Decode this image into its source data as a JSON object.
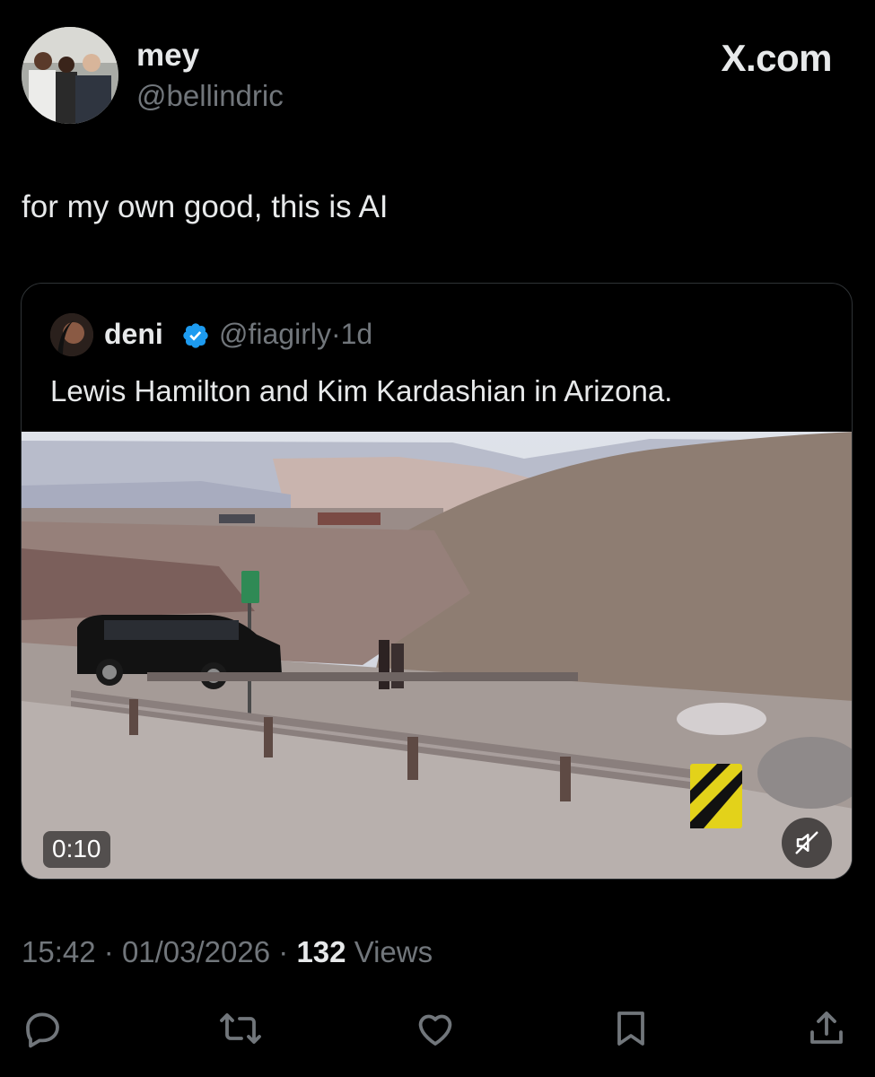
{
  "post": {
    "author_name": "mey",
    "author_handle": "@bellindric",
    "site_label": "X.com",
    "text": "for my own good, this is AI"
  },
  "quote": {
    "author_name": "deni",
    "verified": true,
    "author_handle": "@fiagirly",
    "separator": "·",
    "age": "1d",
    "text": "Lewis Hamilton and Kim Kardashian in Arizona.",
    "video": {
      "duration": "0:10",
      "muted": true
    }
  },
  "meta": {
    "time": "15:42",
    "separator": "·",
    "date": "01/03/2026",
    "views_count": "132",
    "views_label": "Views"
  },
  "actions": [
    "reply-icon",
    "repost-icon",
    "like-icon",
    "bookmark-icon",
    "share-icon"
  ],
  "colors": {
    "background": "#000000",
    "primary_text": "#e7e9ea",
    "secondary_text": "#71767b",
    "border": "#2f3336",
    "verified_badge": "#1d9bf0"
  }
}
